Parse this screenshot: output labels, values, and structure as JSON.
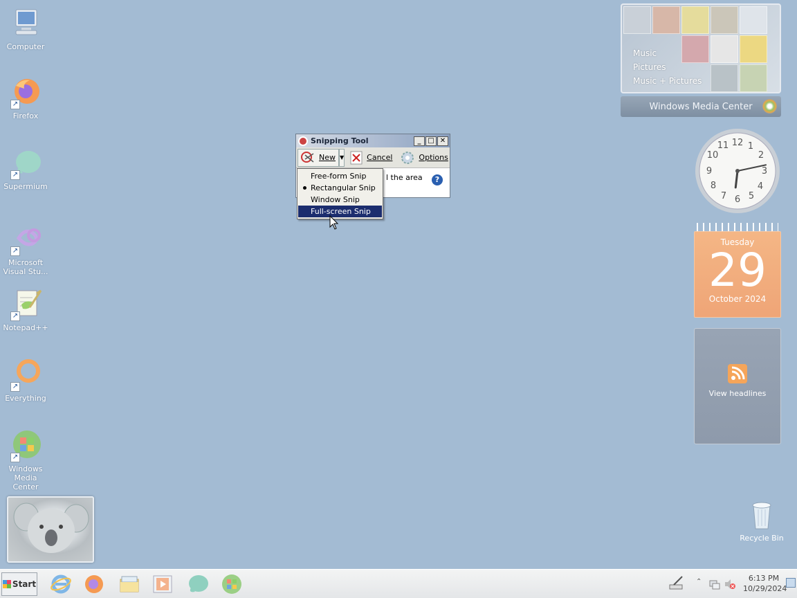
{
  "desktop": {
    "icons": [
      {
        "label": "Computer"
      },
      {
        "label": "Firefox"
      },
      {
        "label": "Supermium"
      },
      {
        "label": "Microsoft Visual Stu..."
      },
      {
        "label": "Notepad++"
      },
      {
        "label": "Everything"
      },
      {
        "label": "Windows Media Center"
      }
    ],
    "recycle_bin": "Recycle Bin",
    "shortcut_glyph": "↗"
  },
  "snipping_tool": {
    "title": "Snipping Tool",
    "new_label": "New",
    "cancel_label": "Cancel",
    "options_label": "Options",
    "body_text": "l the area",
    "help_glyph": "?",
    "window_buttons": {
      "minimize": "_",
      "maximize": "□",
      "close": "✕"
    },
    "menu": [
      {
        "label": "Free-form Snip",
        "selected": false,
        "highlighted": false
      },
      {
        "label": "Rectangular Snip",
        "selected": true,
        "highlighted": false
      },
      {
        "label": "Window Snip",
        "selected": false,
        "highlighted": false
      },
      {
        "label": "Full-screen Snip",
        "selected": false,
        "highlighted": true
      }
    ]
  },
  "gadgets": {
    "media_center": {
      "items": [
        "Music",
        "Pictures",
        "Music + Pictures"
      ],
      "title": "Windows Media Center"
    },
    "clock": {
      "hour": 6,
      "minute": 13
    },
    "calendar": {
      "day": "Tuesday",
      "date": "29",
      "month": "October 2024"
    },
    "feed": {
      "label": "View headlines"
    }
  },
  "taskbar": {
    "start_label": "Start",
    "time": "6:13 PM",
    "date": "10/29/2024",
    "apps": [
      "internet-explorer-icon",
      "firefox-icon",
      "file-explorer-icon",
      "media-player-icon",
      "supermium-icon",
      "media-center-icon"
    ]
  },
  "colors": {
    "desktop": "#a3bbd3",
    "menu_highlight": "#1c2d6e",
    "calendar": "#f4b685"
  }
}
